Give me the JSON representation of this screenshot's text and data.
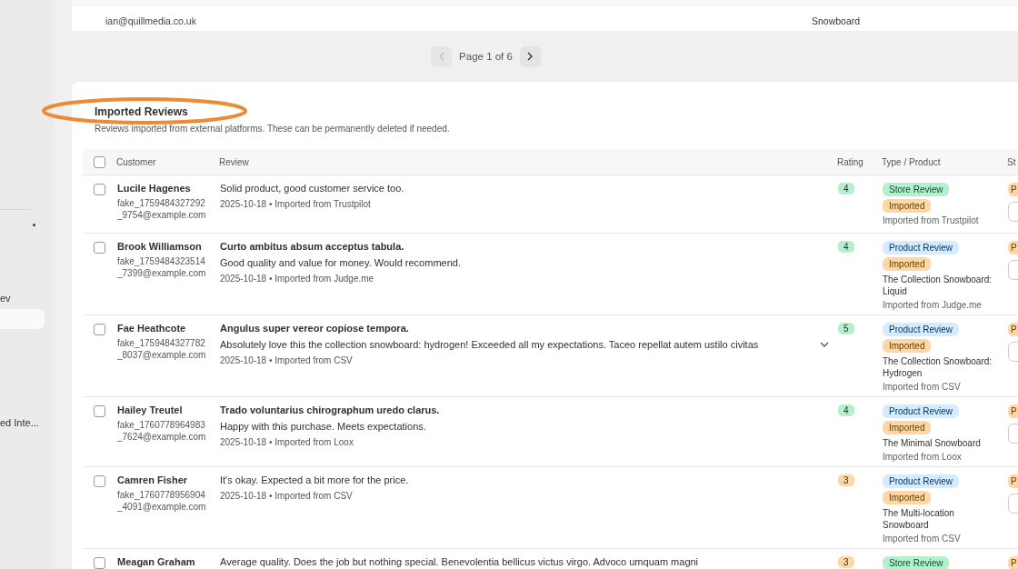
{
  "sidebar": {
    "items": [
      {
        "label": "ev",
        "selected": false
      },
      {
        "selected": true
      },
      {
        "label": "ed Inte...",
        "selected": false
      }
    ]
  },
  "previous_table": {
    "email": "ian@quillmedia.co.uk",
    "product": "Snowboard"
  },
  "pagination": {
    "label": "Page 1 of 6",
    "prev_disabled": true,
    "next_disabled": false
  },
  "section": {
    "title": "Imported Reviews",
    "description": "Reviews imported from external platforms. These can be permanently deleted if needed."
  },
  "table": {
    "all_checked": false,
    "columns": [
      "Customer",
      "Review",
      "Rating",
      "Type / Product",
      "St"
    ],
    "rows": [
      {
        "checked": false,
        "name": "Lucile Hagenes",
        "email": "fake_1759484327292_9754@example.com",
        "body": "Solid product, good customer service too.",
        "meta": "2025-10-18 • Imported from Trustpilot",
        "rating": {
          "label": "4",
          "color": "#b4f0cd"
        },
        "type": {
          "kind": "store",
          "label": "Store Review"
        },
        "tag": "Imported",
        "source": "Imported from Trustpilot",
        "status": "P"
      },
      {
        "checked": false,
        "name": "Brook Williamson",
        "email": "fake_1759484323514_7399@example.com",
        "title": "Curto ambitus absum acceptus tabula.",
        "body": "Good quality and value for money. Would recommend.",
        "meta": "2025-10-18 • Imported from Judge.me",
        "rating": {
          "label": "4",
          "color": "#b4f0cd"
        },
        "type": {
          "kind": "product",
          "label": "Product Review"
        },
        "tag": "Imported",
        "product": "The Collection Snowboard: Liquid",
        "source": "Imported from Judge.me",
        "status": "P"
      },
      {
        "checked": false,
        "name": "Fae Heathcote",
        "email": "fake_1759484327782_8037@example.com",
        "title": "Angulus super vereor copiose tempora.",
        "body": "Absolutely love this the collection snowboard: hydrogen! Exceeded all my expectations. Taceo repellat autem ustilo civitas",
        "expandable": true,
        "meta": "2025-10-18 • Imported from CSV",
        "rating": {
          "label": "5",
          "color": "#b4f0cd"
        },
        "type": {
          "kind": "product",
          "label": "Product Review"
        },
        "tag": "Imported",
        "product": "The Collection Snowboard: Hydrogen",
        "source": "Imported from CSV",
        "status": "P"
      },
      {
        "checked": false,
        "name": "Hailey Treutel",
        "email": "fake_1760778964983_7624@example.com",
        "title": "Trado voluntarius chirographum uredo clarus.",
        "body": "Happy with this purchase. Meets expectations.",
        "meta": "2025-10-18 • Imported from Loox",
        "rating": {
          "label": "4",
          "color": "#b4f0cd"
        },
        "type": {
          "kind": "product",
          "label": "Product Review"
        },
        "tag": "Imported",
        "product": "The Minimal Snowboard",
        "source": "Imported from Loox",
        "status": "P"
      },
      {
        "checked": false,
        "name": "Camren Fisher",
        "email": "fake_1760778956904_4091@example.com",
        "body": "It's okay. Expected a bit more for the price.",
        "meta": "2025-10-18 • Imported from CSV",
        "rating": {
          "label": "3",
          "color": "#ffd6a4"
        },
        "type": {
          "kind": "product",
          "label": "Product Review"
        },
        "tag": "Imported",
        "product": "The Multi-location Snowboard",
        "source": "Imported from CSV",
        "status": "P"
      },
      {
        "checked": false,
        "name": "Meagan Graham",
        "body": "Average quality. Does the job but nothing special. Benevolentia bellicus victus virgo. Advoco umquam magni",
        "rating": {
          "label": "3",
          "color": "#ffd6a4"
        },
        "type": {
          "kind": "store",
          "label": "Store Review"
        },
        "status": "P"
      }
    ]
  }
}
